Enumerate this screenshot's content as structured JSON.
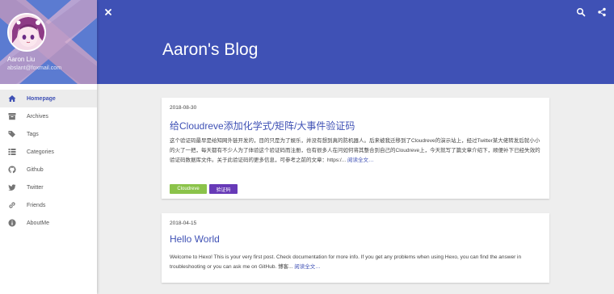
{
  "profile": {
    "name": "Aaron Liu",
    "email": "abslant@foxmail.com"
  },
  "sidebar": {
    "items": [
      {
        "label": "Homepage",
        "icon": "home-icon",
        "active": true
      },
      {
        "label": "Archives",
        "icon": "archive-icon"
      },
      {
        "label": "Tags",
        "icon": "tags-icon"
      },
      {
        "label": "Categories",
        "icon": "list-icon"
      },
      {
        "label": "Github",
        "icon": "github-icon"
      },
      {
        "label": "Twitter",
        "icon": "twitter-icon"
      },
      {
        "label": "Friends",
        "icon": "link-icon"
      },
      {
        "label": "AboutMe",
        "icon": "info-icon"
      }
    ]
  },
  "header": {
    "title": "Aaron's Blog"
  },
  "posts": [
    {
      "date": "2018-08-30",
      "title": "给Cloudreve添加化学式/矩阵/大事件验证码",
      "excerpt": "这个验证码最早是给知网外链开发的，目的只是为了娱乐，并没有想到真的防机器人。后来被我迁移到了Cloudreve的演示站上，经过Twitter某大佬转发后就小小的火了一把，每天都有不少人为了体验这个验证码而注册，也有很多人在问如何将其整合到自己的Cloudreve上，今天就写了篇文章介绍下，顺便补下已经失效的验证码数据库文件。关于此验证码的更多信息，可参考之前的文章：https:/... ",
      "read_more": "阅读全文…",
      "tags": [
        "Cloudreve",
        "验证码"
      ]
    },
    {
      "date": "2018-04-15",
      "title": "Hello World",
      "excerpt": "Welcome to Hexo! This is your very first post. Check documentation for more info. If you get any problems when using Hexo, you can find the answer in troubleshooting or you can ask me on GitHub. 博客... ",
      "read_more": "阅读全文…"
    }
  ],
  "colors": {
    "primary": "#3f51b5",
    "tag_cloudreve": "#8bc34a",
    "tag_captcha": "#673ab7"
  }
}
